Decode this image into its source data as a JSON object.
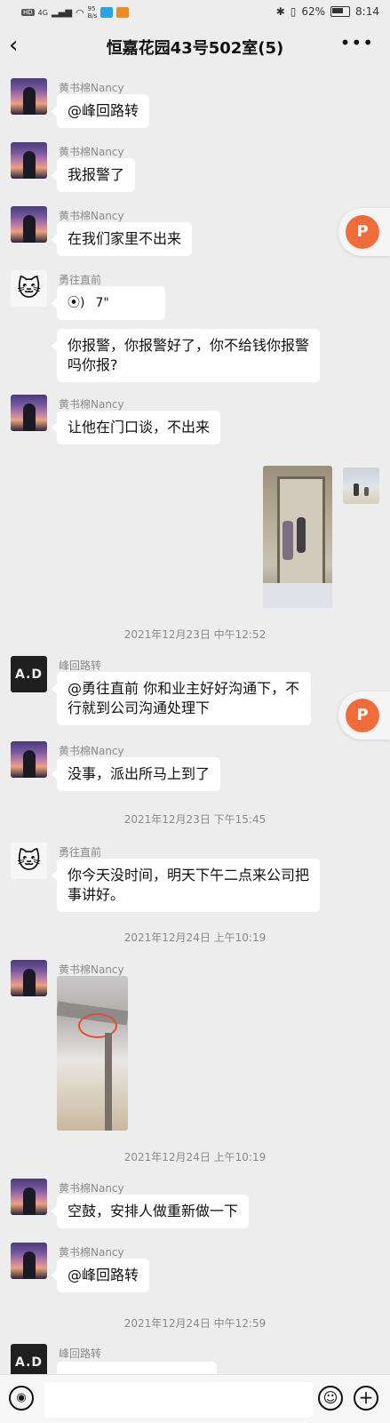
{
  "status_bar": {
    "hd": "HD",
    "network": "4G",
    "speed_value": "95",
    "speed_unit": "B/s",
    "bluetooth_icon": "bluetooth-icon",
    "vibrate_icon": "vibrate-icon",
    "battery": "62%",
    "time": "8:14"
  },
  "header": {
    "back_icon": "chevron-left-icon",
    "title": "恒嘉花园43号502室(5)",
    "more_icon": "more-dots-icon"
  },
  "messages": [
    {
      "sender": "黄书棉Nancy",
      "text": "@峰回路转"
    },
    {
      "sender": "黄书棉Nancy",
      "text": "我报警了"
    },
    {
      "sender": "黄书棉Nancy",
      "text": "在我们家里不出来"
    },
    {
      "sender": "勇往直前",
      "voice_duration": "7\""
    },
    {
      "sender": "勇往直前",
      "text": "你报警，你报警好了，你不给钱你报警吗你报?"
    },
    {
      "sender": "黄书棉Nancy",
      "text": "让他在门口谈，不出来"
    },
    {
      "sender": "我",
      "image": "doorway-photo"
    },
    {
      "timestamp": "2021年12月23日 中午12:52"
    },
    {
      "sender": "峰回路转",
      "text": "@勇往直前  你和业主好好沟通下，不行就到公司沟通处理下"
    },
    {
      "sender": "黄书棉Nancy",
      "text": "没事，派出所马上到了"
    },
    {
      "timestamp": "2021年12月23日 下午15:45"
    },
    {
      "sender": "勇往直前",
      "text": "你今天没时间，明天下午二点来公司把事讲好。"
    },
    {
      "timestamp": "2021年12月24日 上午10:19"
    },
    {
      "sender": "黄书棉Nancy",
      "image": "ceiling-photo"
    },
    {
      "timestamp": "2021年12月24日 上午10:19"
    },
    {
      "sender": "黄书棉Nancy",
      "text": "空鼓，安排人做重新做一下"
    },
    {
      "sender": "黄书棉Nancy",
      "text": "@峰回路转"
    },
    {
      "timestamp": "2021年12月24日 中午12:59"
    },
    {
      "sender": "峰回路转",
      "text": ""
    }
  ],
  "avatars": {
    "ad_text": "A.D"
  },
  "floating": {
    "label": "P",
    "color": "#f26b3a"
  },
  "input_bar": {
    "voice_icon": "voice-input-icon",
    "emoji_icon": "emoji-icon",
    "plus_icon": "plus-icon",
    "placeholder": ""
  },
  "colors": {
    "background": "#ededed",
    "bubble": "#ffffff",
    "accent": "#f26b3a"
  }
}
